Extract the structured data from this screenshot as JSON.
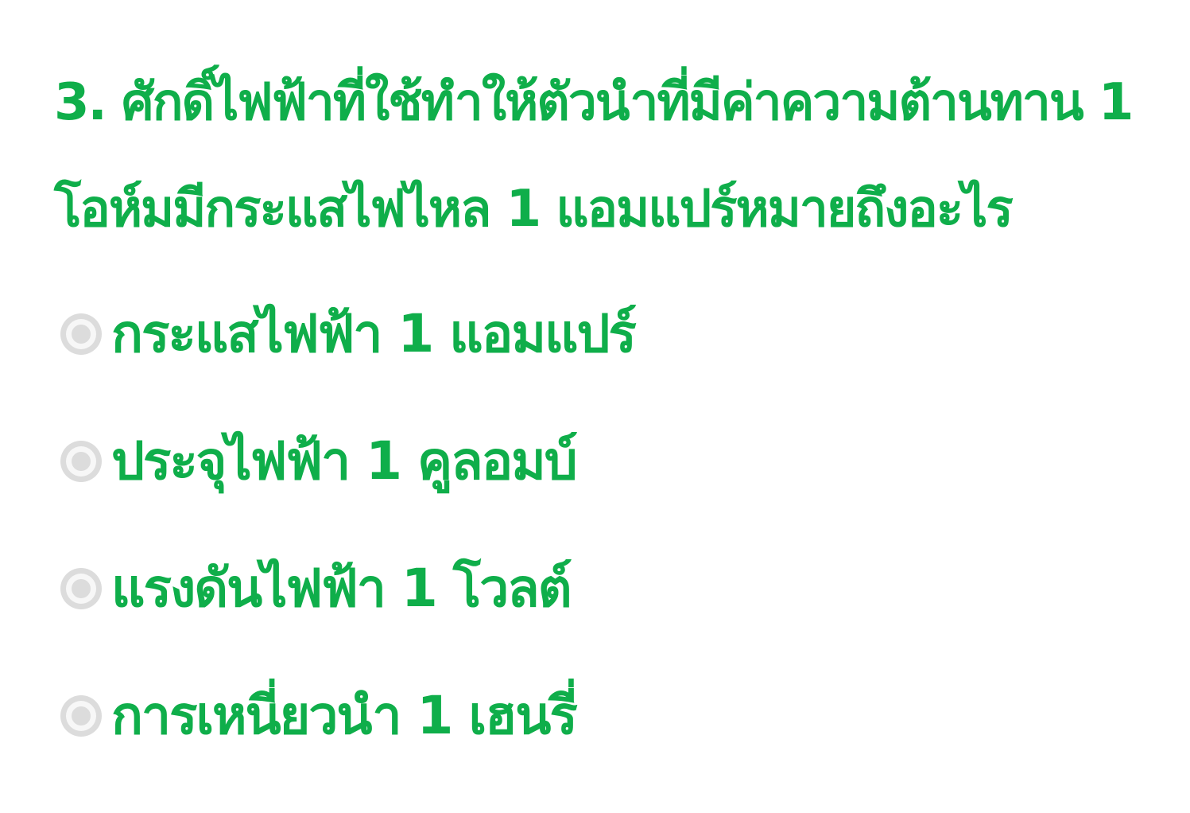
{
  "question": {
    "text": "3. ศักดิ์ไฟฟ้าที่ใช้ทำให้ตัวนำที่มีค่าความต้านทาน 1 โอห์มมีกระแสไฟไหล 1 แอมแปร์หมายถึงอะไร"
  },
  "options": [
    {
      "label": "กระแสไฟฟ้า 1 แอมแปร์"
    },
    {
      "label": "ประจุไฟฟ้า 1 คูลอมบ์"
    },
    {
      "label": "แรงดันไฟฟ้า 1 โวลต์"
    },
    {
      "label": "การเหนี่ยวนำ 1 เฮนรี่"
    }
  ],
  "colors": {
    "text": "#0fae4a",
    "radio": "#dcdcdc",
    "background": "#ffffff"
  }
}
